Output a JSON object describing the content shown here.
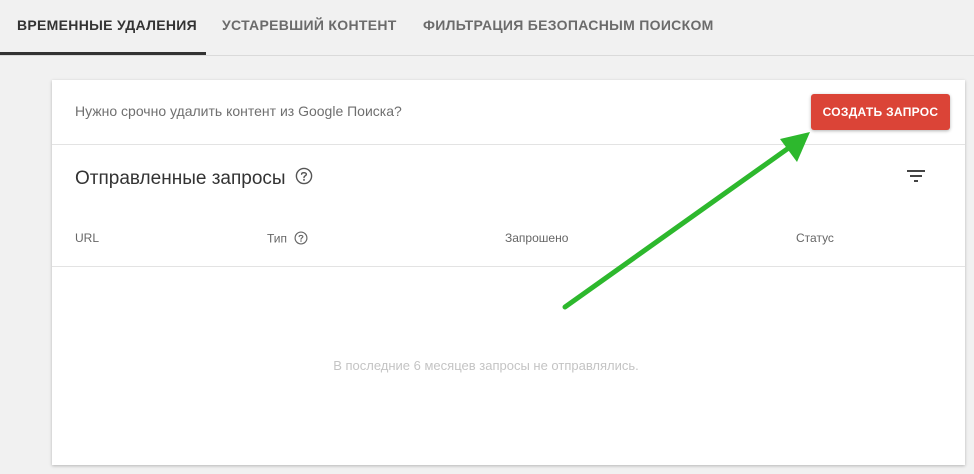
{
  "tabs": [
    {
      "label": "ВРЕМЕННЫЕ УДАЛЕНИЯ",
      "active": true
    },
    {
      "label": "УСТАРЕВШИЙ КОНТЕНТ",
      "active": false
    },
    {
      "label": "ФИЛЬТРАЦИЯ БЕЗОПАСНЫМ ПОИСКОМ",
      "active": false
    }
  ],
  "banner": {
    "text": "Нужно срочно удалить контент из Google Поиска?",
    "button_label": "СОЗДАТЬ ЗАПРОС"
  },
  "requests": {
    "title": "Отправленные запросы",
    "columns": [
      "URL",
      "Тип",
      "Запрошено",
      "Статус"
    ],
    "empty_message": "В последние 6 месяцев запросы не отправлялись."
  },
  "colors": {
    "accent_button": "#db4437",
    "annotation_arrow": "#2db82d"
  },
  "icons": {
    "help": "help-circle-icon",
    "filter": "filter-icon"
  }
}
